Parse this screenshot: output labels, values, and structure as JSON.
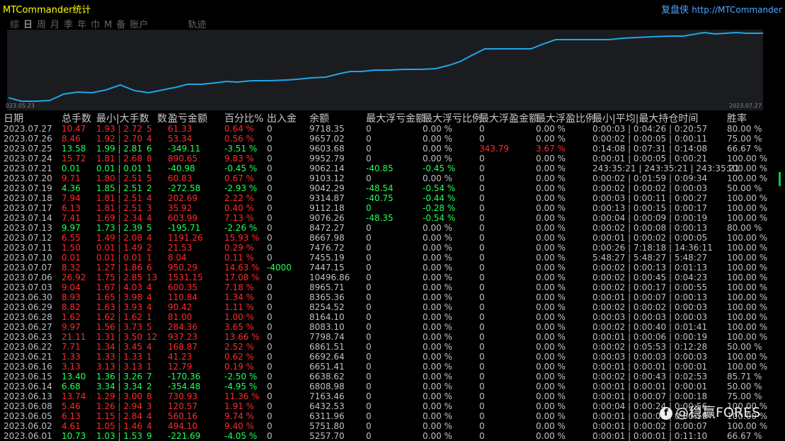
{
  "app": {
    "title": "MTCommander统计",
    "brand": "复盘侠",
    "url": "http://MTCommander"
  },
  "tabs": [
    "综",
    "日",
    "周",
    "月",
    "季",
    "年",
    "巾",
    "M",
    "备",
    "账户",
    "轨迹"
  ],
  "active_tab": "日",
  "chart": {
    "start_date": "023.05.23",
    "end_date": "2023.07.27",
    "line_color": "#1fa6e8"
  },
  "headers": {
    "date": "日期",
    "total_lots": "总手数",
    "min_max": "最小|大手数",
    "count": "数",
    "profit": "盈亏金额",
    "percent": "百分比%",
    "inout": "出入金",
    "balance": "余额",
    "max_float_loss": "最大浮亏金额",
    "max_float_loss_pct": "最大浮亏比例",
    "max_float_profit": "最大浮盈金额",
    "max_float_profit_pct": "最大浮盈比例",
    "hold_time": "最小|平均|最大持仓时间",
    "winrate": "胜率"
  },
  "colors": {
    "profit": "#ff2a2a",
    "loss": "#22ff55",
    "neutral": "#c0c0c0"
  },
  "rows": [
    {
      "date": "2023.07.27",
      "lots": "10.47",
      "mm": "1.93 | 2.72",
      "n": "5",
      "pl": "61.33",
      "pct": "0.64 %",
      "io": "0",
      "bal": "9718.35",
      "fl": "0",
      "flp": "0.00 %",
      "fp": "0",
      "fpp": "0.00 %",
      "ht": "0:00:03 | 0:04:26 | 0:20:57",
      "wr": "80.00 %",
      "c": "r"
    },
    {
      "date": "2023.07.26",
      "lots": "8.46",
      "mm": "1.92 | 2.70",
      "n": "4",
      "pl": "53.34",
      "pct": "0.56 %",
      "io": "0",
      "bal": "9657.02",
      "fl": "0",
      "flp": "0.00 %",
      "fp": "0",
      "fpp": "0.00 %",
      "ht": "0:00:02 | 0:00:05 | 0:00:11",
      "wr": "75.00 %",
      "c": "r"
    },
    {
      "date": "2023.07.25",
      "lots": "13.58",
      "mm": "1.99 | 2.81",
      "n": "6",
      "pl": "-349.11",
      "pct": "-3.51 %",
      "io": "0",
      "bal": "9603.68",
      "fl": "0",
      "flp": "0.00 %",
      "fp": "343.79",
      "fpp": "3.67 %",
      "ht": "0:14:08 | 0:07:31 | 0:14:08",
      "wr": "66.67 %",
      "c": "g",
      "fpc": "r"
    },
    {
      "date": "2023.07.24",
      "lots": "15.72",
      "mm": "1.81 | 2.68",
      "n": "8",
      "pl": "890.65",
      "pct": "9.83 %",
      "io": "0",
      "bal": "9952.79",
      "fl": "0",
      "flp": "0.00 %",
      "fp": "0",
      "fpp": "0.00 %",
      "ht": "0:00:01 | 0:00:05 | 0:00:21",
      "wr": "100.00 %",
      "c": "r"
    },
    {
      "date": "2023.07.21",
      "lots": "0.01",
      "mm": "0.01 | 0.01",
      "n": "1",
      "pl": "-40.98",
      "pct": "-0.45 %",
      "io": "0",
      "bal": "9062.14",
      "fl": "-40.85",
      "flp": "-0.45 %",
      "fp": "0",
      "fpp": "0.00 %",
      "ht": "243:35:21 | 243:35:21 | 243:35:21",
      "wr": "100.00 %",
      "c": "g",
      "flc": "g"
    },
    {
      "date": "2023.07.20",
      "lots": "9.71",
      "mm": "1.80 | 2.51",
      "n": "5",
      "pl": "60.83",
      "pct": "0.67 %",
      "io": "0",
      "bal": "9103.12",
      "fl": "0",
      "flp": "0.00 %",
      "fp": "0",
      "fpp": "0.00 %",
      "ht": "0:00:02 | 0:01:59 | 0:09:34",
      "wr": "100.00 %",
      "c": "r"
    },
    {
      "date": "2023.07.19",
      "lots": "4.36",
      "mm": "1.85 | 2.51",
      "n": "2",
      "pl": "-272.58",
      "pct": "-2.93 %",
      "io": "0",
      "bal": "9042.29",
      "fl": "-48.54",
      "flp": "-0.54 %",
      "fp": "0",
      "fpp": "0.00 %",
      "ht": "0:00:02 | 0:00:02 | 0:00:03",
      "wr": "50.00 %",
      "c": "g",
      "flc": "g"
    },
    {
      "date": "2023.07.18",
      "lots": "7.94",
      "mm": "1.81 | 2.51",
      "n": "4",
      "pl": "202.69",
      "pct": "2.22 %",
      "io": "0",
      "bal": "9314.87",
      "fl": "-40.75",
      "flp": "-0.44 %",
      "fp": "0",
      "fpp": "0.00 %",
      "ht": "0:00:03 | 0:00:11 | 0:00:27",
      "wr": "100.00 %",
      "c": "r",
      "flc": "g"
    },
    {
      "date": "2023.07.17",
      "lots": "6.13",
      "mm": "1.81 | 2.51",
      "n": "3",
      "pl": "35.92",
      "pct": "0.40 %",
      "io": "0",
      "bal": "9112.18",
      "fl": "0",
      "flp": "-0.28 %",
      "fp": "0",
      "fpp": "0.00 %",
      "ht": "0:00:13 | 0:00:15 | 0:00:17",
      "wr": "100.00 %",
      "c": "r",
      "flc": "g"
    },
    {
      "date": "2023.07.14",
      "lots": "7.41",
      "mm": "1.69 | 2.34",
      "n": "4",
      "pl": "603.99",
      "pct": "7.13 %",
      "io": "0",
      "bal": "9076.26",
      "fl": "-48.35",
      "flp": "-0.54 %",
      "fp": "0",
      "fpp": "0.00 %",
      "ht": "0:00:04 | 0:00:09 | 0:00:19",
      "wr": "100.00 %",
      "c": "r",
      "flc": "g"
    },
    {
      "date": "2023.07.13",
      "lots": "9.97",
      "mm": "1.73 | 2.39",
      "n": "5",
      "pl": "-195.71",
      "pct": "-2.26 %",
      "io": "0",
      "bal": "8472.27",
      "fl": "0",
      "flp": "0.00 %",
      "fp": "0",
      "fpp": "0.00 %",
      "ht": "0:00:02 | 0:00:08 | 0:00:13",
      "wr": "80.00 %",
      "c": "g"
    },
    {
      "date": "2023.07.12",
      "lots": "6.55",
      "mm": "1.49 | 2.08",
      "n": "4",
      "pl": "1191.26",
      "pct": "15.93 %",
      "io": "0",
      "bal": "8667.98",
      "fl": "0",
      "flp": "0.00 %",
      "fp": "0",
      "fpp": "0.00 %",
      "ht": "0:00:01 | 0:00:02 | 0:00:05",
      "wr": "100.00 %",
      "c": "r"
    },
    {
      "date": "2023.07.11",
      "lots": "1.50",
      "mm": "0.01 | 1.49",
      "n": "2",
      "pl": "21.53",
      "pct": "0.29 %",
      "io": "0",
      "bal": "7476.72",
      "fl": "0",
      "flp": "0.00 %",
      "fp": "0",
      "fpp": "0.00 %",
      "ht": "0:00:26 | 7:18:18 | 14:36:11",
      "wr": "100.00 %",
      "c": "r"
    },
    {
      "date": "2023.07.10",
      "lots": "0.01",
      "mm": "0.01 | 0.01",
      "n": "1",
      "pl": "8.04",
      "pct": "0.11 %",
      "io": "0",
      "bal": "7455.19",
      "fl": "0",
      "flp": "0.00 %",
      "fp": "0",
      "fpp": "0.00 %",
      "ht": "5:48:27 | 5:48:27 | 5:48:27",
      "wr": "100.00 %",
      "c": "r"
    },
    {
      "date": "2023.07.07",
      "lots": "8.32",
      "mm": "1.27 | 1.86",
      "n": "6",
      "pl": "950.29",
      "pct": "14.63 %",
      "io": "-4000",
      "bal": "7447.15",
      "fl": "0",
      "flp": "0.00 %",
      "fp": "0",
      "fpp": "0.00 %",
      "ht": "0:00:02 | 0:00:13 | 0:01:13",
      "wr": "100.00 %",
      "c": "r",
      "ioc": "g"
    },
    {
      "date": "2023.07.06",
      "lots": "26.92",
      "mm": "1.75 | 2.85",
      "n": "13",
      "pl": "1531.15",
      "pct": "17.08 %",
      "io": "0",
      "bal": "10496.86",
      "fl": "0",
      "flp": "0.00 %",
      "fp": "0",
      "fpp": "0.00 %",
      "ht": "0:00:02 | 0:00:45 | 0:04:23",
      "wr": "100.00 %",
      "c": "r"
    },
    {
      "date": "2023.07.03",
      "lots": "9.04",
      "mm": "1.67 | 4.03",
      "n": "4",
      "pl": "600.35",
      "pct": "7.18 %",
      "io": "0",
      "bal": "8965.71",
      "fl": "0",
      "flp": "0.00 %",
      "fp": "0",
      "fpp": "0.00 %",
      "ht": "0:00:02 | 0:00:17 | 0:00:55",
      "wr": "100.00 %",
      "c": "r"
    },
    {
      "date": "2023.06.30",
      "lots": "8.93",
      "mm": "1.65 | 3.98",
      "n": "4",
      "pl": "110.84",
      "pct": "1.34 %",
      "io": "0",
      "bal": "8365.36",
      "fl": "0",
      "flp": "0.00 %",
      "fp": "0",
      "fpp": "0.00 %",
      "ht": "0:00:01 | 0:00:07 | 0:00:13",
      "wr": "100.00 %",
      "c": "r"
    },
    {
      "date": "2023.06.29",
      "lots": "8.82",
      "mm": "1.63 | 3.93",
      "n": "4",
      "pl": "90.42",
      "pct": "1.11 %",
      "io": "0",
      "bal": "8254.52",
      "fl": "0",
      "flp": "0.00 %",
      "fp": "0",
      "fpp": "0.00 %",
      "ht": "0:00:02 | 0:00:02 | 0:00:03",
      "wr": "100.00 %",
      "c": "r"
    },
    {
      "date": "2023.06.28",
      "lots": "1.62",
      "mm": "1.62 | 1.62",
      "n": "1",
      "pl": "81.00",
      "pct": "1.00 %",
      "io": "0",
      "bal": "8164.10",
      "fl": "0",
      "flp": "0.00 %",
      "fp": "0",
      "fpp": "0.00 %",
      "ht": "0:00:03 | 0:00:03 | 0:00:03",
      "wr": "100.00 %",
      "c": "r"
    },
    {
      "date": "2023.06.27",
      "lots": "9.97",
      "mm": "1.56 | 3.73",
      "n": "5",
      "pl": "284.36",
      "pct": "3.65 %",
      "io": "0",
      "bal": "8083.10",
      "fl": "0",
      "flp": "0.00 %",
      "fp": "0",
      "fpp": "0.00 %",
      "ht": "0:00:02 | 0:00:40 | 0:01:41",
      "wr": "100.00 %",
      "c": "r"
    },
    {
      "date": "2023.06.23",
      "lots": "21.11",
      "mm": "1.31 | 3.50",
      "n": "12",
      "pl": "937.23",
      "pct": "13.66 %",
      "io": "0",
      "bal": "7798.74",
      "fl": "0",
      "flp": "0.00 %",
      "fp": "0",
      "fpp": "0.00 %",
      "ht": "0:00:01 | 0:00:06 | 0:00:19",
      "wr": "100.00 %",
      "c": "r"
    },
    {
      "date": "2023.06.22",
      "lots": "7.71",
      "mm": "1.34 | 3.45",
      "n": "4",
      "pl": "168.87",
      "pct": "2.52 %",
      "io": "0",
      "bal": "6861.51",
      "fl": "0",
      "flp": "0.00 %",
      "fp": "0",
      "fpp": "0.00 %",
      "ht": "0:00:02 | 0:05:53 | 0:12:28",
      "wr": "50.00 %",
      "c": "r"
    },
    {
      "date": "2023.06.21",
      "lots": "1.33",
      "mm": "1.33 | 1.33",
      "n": "1",
      "pl": "41.23",
      "pct": "0.62 %",
      "io": "0",
      "bal": "6692.64",
      "fl": "0",
      "flp": "0.00 %",
      "fp": "0",
      "fpp": "0.00 %",
      "ht": "0:00:03 | 0:00:03 | 0:00:03",
      "wr": "100.00 %",
      "c": "r"
    },
    {
      "date": "2023.06.16",
      "lots": "3.13",
      "mm": "3.13 | 3.13",
      "n": "1",
      "pl": "12.79",
      "pct": "0.19 %",
      "io": "0",
      "bal": "6651.41",
      "fl": "0",
      "flp": "0.00 %",
      "fp": "0",
      "fpp": "0.00 %",
      "ht": "0:00:01 | 0:00:01 | 0:00:01",
      "wr": "100.00 %",
      "c": "r"
    },
    {
      "date": "2023.06.15",
      "lots": "13.40",
      "mm": "1.36 | 3.26",
      "n": "7",
      "pl": "-170.36",
      "pct": "-2.50 %",
      "io": "0",
      "bal": "6638.62",
      "fl": "0",
      "flp": "0.00 %",
      "fp": "0",
      "fpp": "0.00 %",
      "ht": "0:00:02 | 0:00:43 | 0:02:53",
      "wr": "85.71 %",
      "c": "g"
    },
    {
      "date": "2023.06.14",
      "lots": "6.68",
      "mm": "3.34 | 3.34",
      "n": "2",
      "pl": "-354.48",
      "pct": "-4.95 %",
      "io": "0",
      "bal": "6808.98",
      "fl": "0",
      "flp": "0.00 %",
      "fp": "0",
      "fpp": "0.00 %",
      "ht": "0:00:01 | 0:00:01 | 0:00:01",
      "wr": "50.00 %",
      "c": "g"
    },
    {
      "date": "2023.06.13",
      "lots": "13.74",
      "mm": "1.29 | 3.00",
      "n": "8",
      "pl": "730.93",
      "pct": "11.36 %",
      "io": "0",
      "bal": "7163.46",
      "fl": "0",
      "flp": "0.00 %",
      "fp": "0",
      "fpp": "0.00 %",
      "ht": "0:00:01 | 0:00:07 | 0:00:18",
      "wr": "75.00 %",
      "c": "r"
    },
    {
      "date": "2023.06.08",
      "lots": "5.46",
      "mm": "1.26 | 2.94",
      "n": "3",
      "pl": "120.57",
      "pct": "1.91 %",
      "io": "0",
      "bal": "6432.53",
      "fl": "0",
      "flp": "0.00 %",
      "fp": "0",
      "fpp": "0.00 %",
      "ht": "0:00:04 | 0:00:24 | 0:00:56",
      "wr": "100.00 %",
      "c": "r"
    },
    {
      "date": "2023.06.05",
      "lots": "6.13",
      "mm": "1.15 | 2.84",
      "n": "4",
      "pl": "560.16",
      "pct": "9.74 %",
      "io": "0",
      "bal": "6311.96",
      "fl": "0",
      "flp": "0.00 %",
      "fp": "0",
      "fpp": "0.00 %",
      "ht": "0:00:01 | 0:00:09 | 0:00:19",
      "wr": "100.00 %",
      "c": "r"
    },
    {
      "date": "2023.06.02",
      "lots": "4.61",
      "mm": "1.05 | 1.46",
      "n": "4",
      "pl": "494.10",
      "pct": "9.40 %",
      "io": "0",
      "bal": "5751.80",
      "fl": "0",
      "flp": "0.00 %",
      "fp": "0",
      "fpp": "0.00 %",
      "ht": "0:00:01 | 0:00:02 | 0:00:07",
      "wr": "100.00 %",
      "c": "r"
    },
    {
      "date": "2023.06.01",
      "lots": "10.73",
      "mm": "1.03 | 1.53",
      "n": "9",
      "pl": "-221.69",
      "pct": "-4.05 %",
      "io": "0",
      "bal": "5257.70",
      "fl": "0",
      "flp": "0.00 %",
      "fp": "0",
      "fpp": "0.00 %",
      "ht": "0:00:01 | 0:00:01 | 0:11:10",
      "wr": "66.67 %",
      "c": "g"
    }
  ],
  "watermark": "@稳赢FORES"
}
